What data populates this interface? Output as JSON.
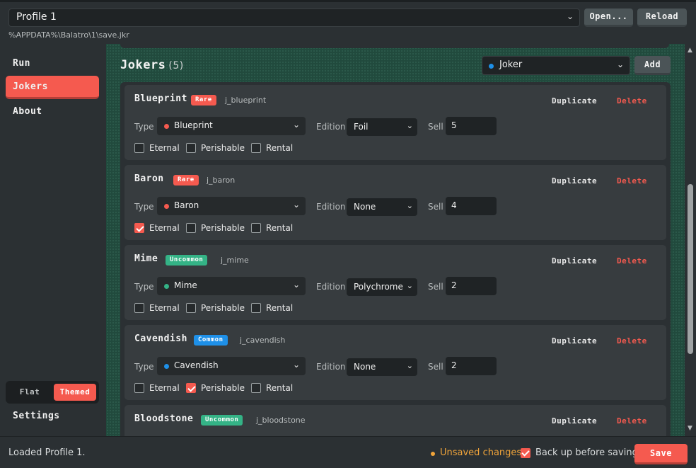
{
  "header": {
    "profile_value": "Profile 1",
    "open_label": "Open...",
    "reload_label": "Reload",
    "path": "%APPDATA%\\Balatro\\1\\save.jkr"
  },
  "sidebar": {
    "items": [
      {
        "label": "Run",
        "active": false
      },
      {
        "label": "Jokers",
        "active": true
      },
      {
        "label": "About",
        "active": false
      }
    ],
    "theme_toggle": {
      "flat": "Flat",
      "themed": "Themed",
      "selected": "Themed"
    },
    "settings_label": "Settings"
  },
  "main": {
    "title": "Jokers",
    "count": "(5)",
    "joker_select": "Joker",
    "add_label": "Add",
    "labels": {
      "type": "Type",
      "edition": "Edition",
      "sell": "Sell",
      "eternal": "Eternal",
      "perishable": "Perishable",
      "rental": "Rental",
      "duplicate": "Duplicate",
      "delete": "Delete"
    },
    "cards": [
      {
        "name": "Blueprint",
        "rarity": "Rare",
        "id": "j_blueprint",
        "type": "Blueprint",
        "edition": "Foil",
        "sell": "5",
        "eternal": false,
        "perishable": false,
        "rental": false
      },
      {
        "name": "Baron",
        "rarity": "Rare",
        "id": "j_baron",
        "type": "Baron",
        "edition": "None",
        "sell": "4",
        "eternal": true,
        "perishable": false,
        "rental": false
      },
      {
        "name": "Mime",
        "rarity": "Uncommon",
        "id": "j_mime",
        "type": "Mime",
        "edition": "Polychrome",
        "sell": "2",
        "eternal": false,
        "perishable": false,
        "rental": false
      },
      {
        "name": "Cavendish",
        "rarity": "Common",
        "id": "j_cavendish",
        "type": "Cavendish",
        "edition": "None",
        "sell": "2",
        "eternal": false,
        "perishable": true,
        "rental": false
      },
      {
        "name": "Bloodstone",
        "rarity": "Uncommon",
        "id": "j_bloodstone"
      }
    ]
  },
  "status": {
    "message": "Loaded Profile 1.",
    "unsaved": "Unsaved changes",
    "backup_label": "Back up before saving",
    "backup_checked": true,
    "save_label": "Save"
  },
  "colors": {
    "accent": "#f55a4f",
    "rare": "#f55a4f",
    "uncommon": "#34b386",
    "common": "#1e90e8",
    "unsaved": "#f0a43a",
    "main_bg": "#214a3d"
  }
}
